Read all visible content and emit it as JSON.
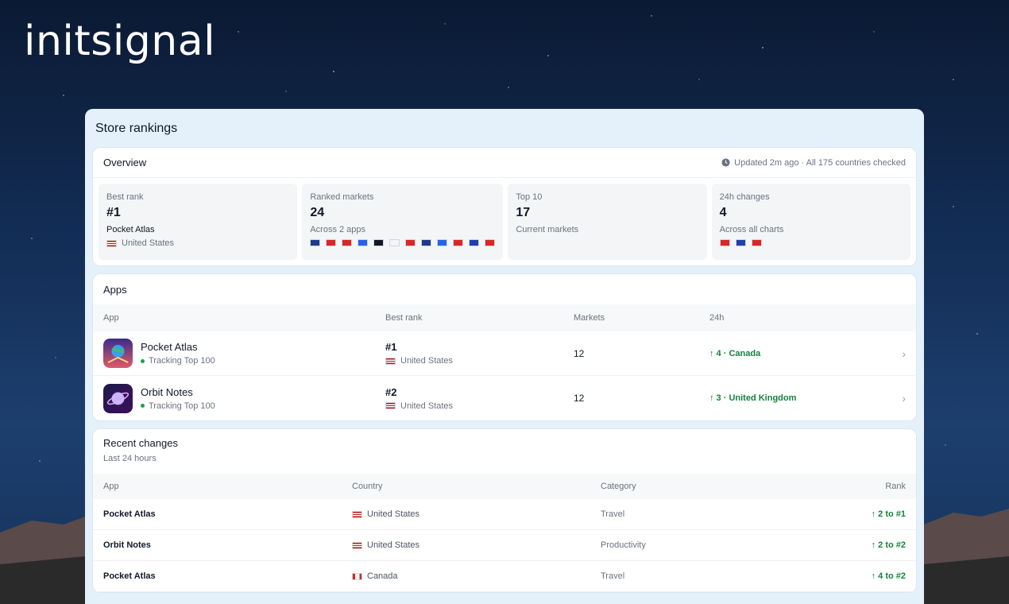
{
  "brand": "initsignal",
  "panel_title": "Store rankings",
  "overview": {
    "title": "Overview",
    "meta": "Updated 2m ago · All 175 countries checked",
    "stats": [
      {
        "label": "Best rank",
        "value": "#1",
        "sub": "Pocket Atlas",
        "country": "United States"
      },
      {
        "label": "Ranked markets",
        "value": "24",
        "sub": "Across 2 apps",
        "flags": [
          "#1e3a8a",
          "#dc2626",
          "#dc2626",
          "#2563eb",
          "#111827",
          "#f3f4f6",
          "#dc2626",
          "#1e3a8a",
          "#2563eb",
          "#dc2626",
          "#1e40af",
          "#dc2626"
        ]
      },
      {
        "label": "Top 10",
        "value": "17",
        "sub": "Current markets"
      },
      {
        "label": "24h changes",
        "value": "4",
        "sub": "Across all charts",
        "flags": [
          "#dc2626",
          "#1e40af",
          "#dc2626"
        ]
      }
    ]
  },
  "apps": {
    "title": "Apps",
    "headers": [
      "App",
      "Best rank",
      "Markets",
      "24h"
    ],
    "rows": [
      {
        "name": "Pocket Atlas",
        "status": "Tracking Top 100",
        "rank": "#1",
        "country": "United States",
        "markets": "12",
        "change": "↑ 4 · Canada"
      },
      {
        "name": "Orbit Notes",
        "status": "Tracking Top 100",
        "rank": "#2",
        "country": "United States",
        "markets": "12",
        "change": "↑ 3 · United Kingdom"
      }
    ]
  },
  "recent": {
    "title": "Recent changes",
    "subtitle": "Last 24 hours",
    "headers": [
      "App",
      "Country",
      "Category",
      "Rank"
    ],
    "rows": [
      {
        "app": "Pocket Atlas",
        "country": "United States",
        "category": "Travel",
        "rank": "↑ 2 to #1"
      },
      {
        "app": "Orbit Notes",
        "country": "United States",
        "category": "Productivity",
        "rank": "↑ 2 to #2"
      },
      {
        "app": "Pocket Atlas",
        "country": "Canada",
        "category": "Travel",
        "rank": "↑ 4 to #2"
      }
    ]
  },
  "colors": {
    "accent_green": "#15803d",
    "panel_bg": "#e4f1fb"
  }
}
